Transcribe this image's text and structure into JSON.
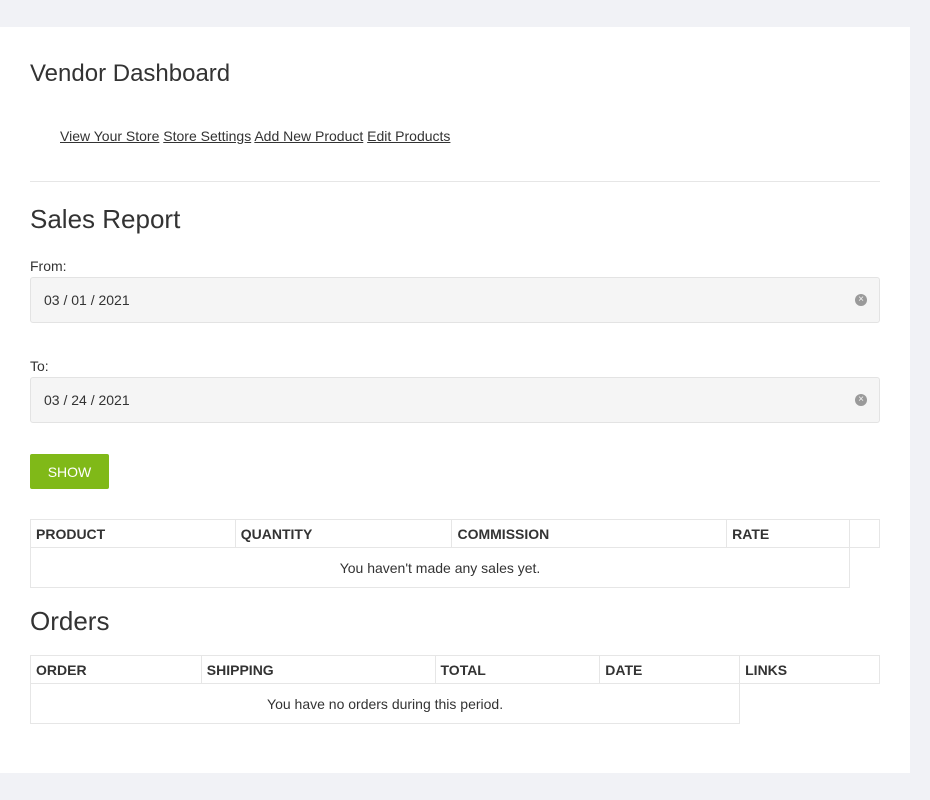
{
  "header": {
    "title": "Vendor Dashboard"
  },
  "nav": {
    "links": [
      {
        "label": "View Your Store"
      },
      {
        "label": "Store Settings"
      },
      {
        "label": "Add New Product"
      },
      {
        "label": "Edit Products"
      }
    ]
  },
  "sales_report": {
    "title": "Sales Report",
    "from_label": "From:",
    "from_value": "03 / 01 / 2021",
    "to_label": "To:",
    "to_value": "03 / 24 / 2021",
    "clear_glyph": "×",
    "show_label": "Show",
    "columns": [
      "PRODUCT",
      "QUANTITY",
      "COMMISSION",
      "RATE"
    ],
    "empty_message": "You haven't made any sales yet."
  },
  "orders": {
    "title": "Orders",
    "columns": [
      "ORDER",
      "SHIPPING",
      "TOTAL",
      "DATE",
      "LINKS"
    ],
    "empty_message": "You have no orders during this period."
  },
  "colors": {
    "accent": "#80b918",
    "background": "#f1f2f6",
    "card": "#ffffff"
  }
}
